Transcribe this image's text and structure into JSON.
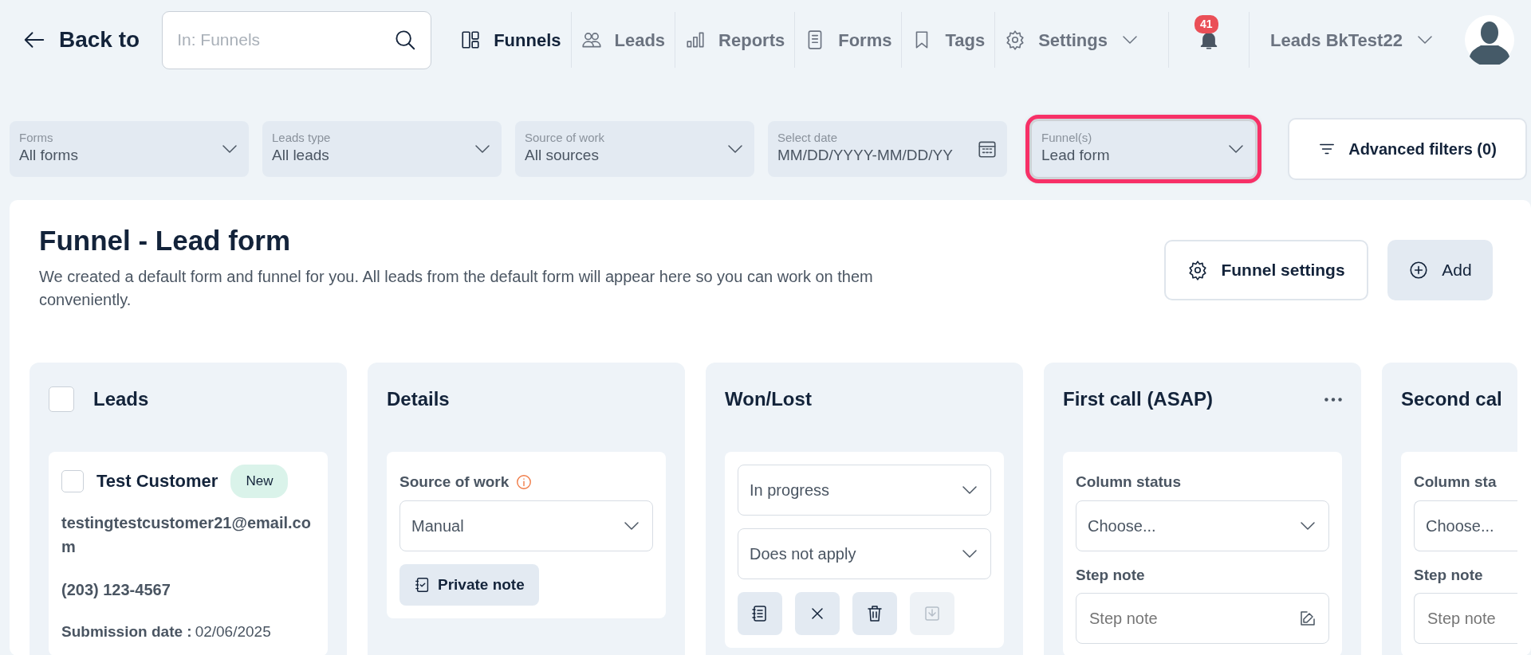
{
  "header": {
    "back_label": "Back to",
    "search": {
      "placeholder": "In: Funnels"
    },
    "nav": [
      {
        "label": "Funnels",
        "kind": "funnels",
        "selected": true
      },
      {
        "label": "Leads",
        "kind": "leads",
        "selected": false
      },
      {
        "label": "Reports",
        "kind": "reports",
        "selected": false
      },
      {
        "label": "Forms",
        "kind": "forms",
        "selected": false
      },
      {
        "label": "Tags",
        "kind": "tags",
        "selected": false
      },
      {
        "label": "Settings",
        "kind": "settings",
        "selected": false
      }
    ],
    "notifications": {
      "count": "41"
    },
    "account": {
      "label": "Leads BkTest22"
    }
  },
  "filters": [
    {
      "label": "Forms",
      "value": "All forms",
      "kind": "select",
      "highlighted": false
    },
    {
      "label": "Leads type",
      "value": "All leads",
      "kind": "select",
      "highlighted": false
    },
    {
      "label": "Source of work",
      "value": "All sources",
      "kind": "select",
      "highlighted": false
    },
    {
      "label": "Select date",
      "value": "MM/DD/YYYY-MM/DD/YY",
      "kind": "date",
      "highlighted": false
    },
    {
      "label": "Funnel(s)",
      "value": "Lead form",
      "kind": "select",
      "highlighted": true
    }
  ],
  "advanced_filters": {
    "label": "Advanced filters (0)"
  },
  "funnel": {
    "title": "Funnel - Lead form",
    "description": "We created a default form and funnel for you. All leads from the default form will appear here so you can work on them conveniently.",
    "buttons": [
      {
        "label": "Funnel settings",
        "kind": "settings"
      },
      {
        "label": "Add",
        "kind": "add"
      }
    ]
  },
  "columns": [
    {
      "kind": "leads",
      "title": "Leads",
      "checked": false,
      "clipped": false,
      "lead": {
        "name": "Test Customer",
        "badge": "New",
        "checked": false,
        "email": "testingtestcustomer21@email.com",
        "phone": "(203) 123-4567",
        "date_label": "Submission date :",
        "date": "02/06/2025"
      }
    },
    {
      "kind": "details",
      "title": "Details",
      "clipped": false,
      "field_label": "Source of work",
      "value": "Manual",
      "note_button": "Private note"
    },
    {
      "kind": "won_lost",
      "title": "Won/Lost",
      "clipped": false,
      "selects": [
        "In progress",
        "Does not apply"
      ],
      "actions": [
        {
          "kind": "note",
          "disabled": false
        },
        {
          "kind": "close",
          "disabled": false
        },
        {
          "kind": "trash",
          "disabled": false
        },
        {
          "kind": "download",
          "disabled": true
        }
      ]
    },
    {
      "kind": "step",
      "title": "First call (ASAP)",
      "menu": true,
      "clipped": false,
      "status_label": "Column status",
      "status_value": "Choose...",
      "note_label": "Step note",
      "note_placeholder": "Step note"
    },
    {
      "kind": "step",
      "title": "Second cal",
      "menu": false,
      "clipped": true,
      "status_label": "Column sta",
      "status_value": "Choose...",
      "note_label": "Step note",
      "note_placeholder": "Step note"
    }
  ]
}
